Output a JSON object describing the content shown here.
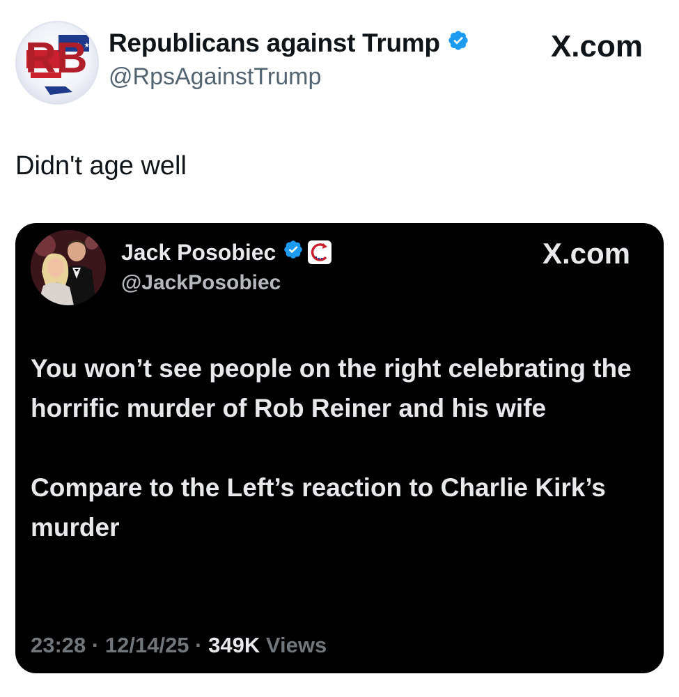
{
  "outer_post": {
    "display_name": "Republicans against Trump",
    "handle": "@RpsAgainstTrump",
    "source_label": "X.com",
    "avatar_letters": "RB",
    "text": "Didn't age well",
    "verified_color": "#1d9bf0"
  },
  "quoted_post": {
    "display_name": "Jack Posobiec",
    "handle": "@JackPosobiec",
    "source_label": "X.com",
    "paragraphs": [
      "You won’t see people on the right celebrating the horrific murder of Rob Reiner and his wife",
      "Compare to the Left’s reaction to Charlie Kirk’s murder"
    ],
    "time": "23:28",
    "date": "12/14/25",
    "separator": "·",
    "views_count": "349K",
    "views_label": "Views",
    "verified_color": "#1d9bf0",
    "affiliate_badge_icon": "affiliate-badge-icon"
  }
}
